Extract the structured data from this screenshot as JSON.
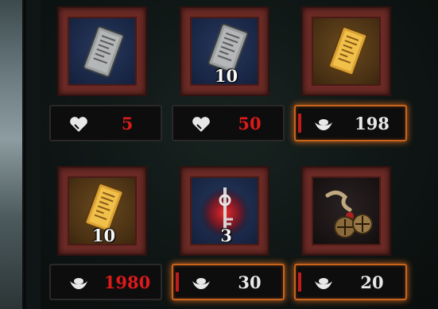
{
  "slots": [
    {
      "id": "1",
      "item_icon": "blank-scroll-icon",
      "currency_icon": "heart-icon",
      "price": "5",
      "qty": "",
      "price_color": "#dd1a1a",
      "highlighted": false
    },
    {
      "id": "2",
      "item_icon": "blank-scroll-icon",
      "currency_icon": "heart-icon",
      "price": "50",
      "qty": "10",
      "price_color": "#dd1a1a",
      "highlighted": false
    },
    {
      "id": "3",
      "item_icon": "gold-scroll-icon",
      "currency_icon": "silver-ingot-icon",
      "price": "198",
      "qty": "",
      "price_color": "#e8e8e8",
      "highlighted": true
    },
    {
      "id": "4",
      "item_icon": "gold-scroll-icon",
      "currency_icon": "silver-ingot-icon",
      "price": "1980",
      "qty": "10",
      "price_color": "#dd1a1a",
      "highlighted": false
    },
    {
      "id": "5",
      "item_icon": "crimson-key-icon",
      "currency_icon": "silver-ingot-icon",
      "price": "30",
      "qty": "3",
      "price_color": "#e8e8e8",
      "highlighted": true
    },
    {
      "id": "6",
      "item_icon": "bells-icon",
      "currency_icon": "silver-ingot-icon",
      "price": "20",
      "qty": "",
      "price_color": "#e8e8e8",
      "highlighted": true
    }
  ]
}
